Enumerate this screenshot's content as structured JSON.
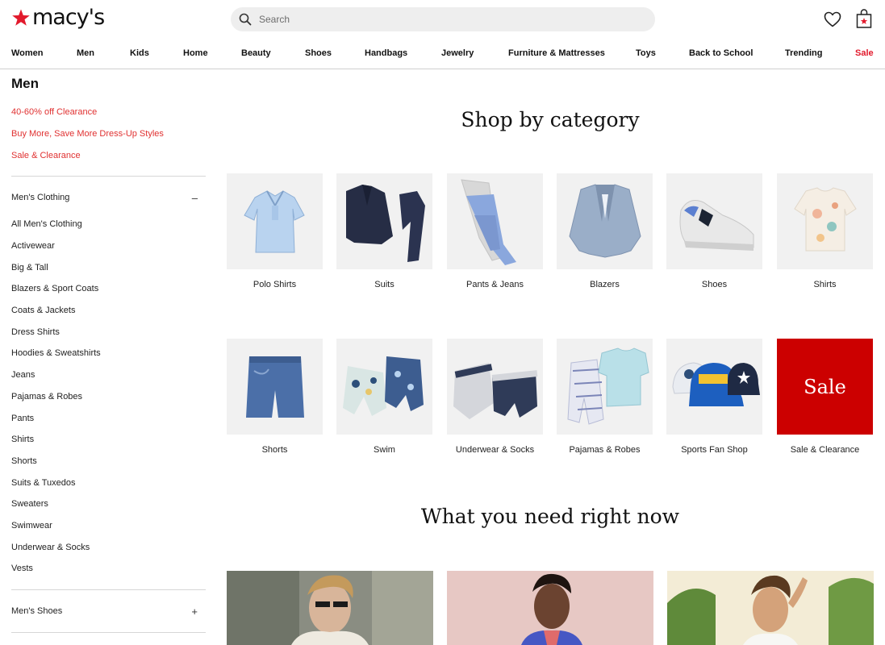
{
  "header": {
    "logo_text": "macy's",
    "logo_star_color": "#e21a2c",
    "search_placeholder": "Search",
    "icons": [
      "search-icon",
      "heart-icon",
      "shopping-bag-icon"
    ]
  },
  "nav": {
    "items": [
      "Women",
      "Men",
      "Kids",
      "Home",
      "Beauty",
      "Shoes",
      "Handbags",
      "Jewelry",
      "Furniture & Mattresses",
      "Toys",
      "Back to School",
      "Trending",
      "Sale"
    ],
    "sale_color": "#e21a2c"
  },
  "sidebar": {
    "title": "Men",
    "promos": [
      "40-60% off Clearance",
      "Buy More, Save More Dress-Up Styles",
      "Sale & Clearance"
    ],
    "promo_color": "#e03131",
    "clothing_section": {
      "label": "Men's Clothing",
      "toggle": "–",
      "links": [
        "All Men's Clothing",
        "Activewear",
        "Big & Tall",
        "Blazers & Sport Coats",
        "Coats & Jackets",
        "Dress Shirts",
        "Hoodies & Sweatshirts",
        "Jeans",
        "Pajamas & Robes",
        "Pants",
        "Shirts",
        "Shorts",
        "Suits & Tuxedos",
        "Sweaters",
        "Swimwear",
        "Underwear & Socks",
        "Vests"
      ]
    },
    "shoes_section": {
      "label": "Men's Shoes",
      "toggle": "+"
    }
  },
  "main": {
    "category_heading": "Shop by category",
    "categories": [
      {
        "label": "Polo Shirts"
      },
      {
        "label": "Suits"
      },
      {
        "label": "Pants & Jeans"
      },
      {
        "label": "Blazers"
      },
      {
        "label": "Shoes"
      },
      {
        "label": "Shirts"
      },
      {
        "label": "Shorts"
      },
      {
        "label": "Swim"
      },
      {
        "label": "Underwear & Socks"
      },
      {
        "label": "Pajamas & Robes"
      },
      {
        "label": "Sports Fan Shop"
      },
      {
        "label": "Sale & Clearance",
        "tile_text": "Sale",
        "tile_color": "#cc0000"
      }
    ],
    "now_heading": "What you need right now"
  }
}
